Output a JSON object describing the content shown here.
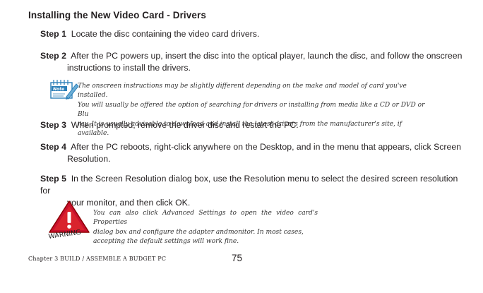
{
  "heading": "Installing the New Video Card - Drivers",
  "steps": [
    {
      "num": "Step 1",
      "line1": "Locate the disc containing the video card drivers.",
      "line2": ""
    },
    {
      "num": "Step 2",
      "line1": "After the PC powers up, insert the disc into the optical player, launch the disc, and follow the onscreen",
      "line2": "instructions to install the drivers."
    },
    {
      "num": "Step 3",
      "line1": "When prompted, remove the driver disc and restart the PC.",
      "line2": ""
    },
    {
      "num": "Step 4",
      "line1": "After the PC reboots, right-click anywhere on the Desktop, and in the menu that appears, click Screen",
      "line2": "Resolution."
    },
    {
      "num": "Step 5",
      "line1": "In the Screen Resolution dialog box, use the Resolution menu to select the desired screen resolution for",
      "line2": "your monitor, and then click OK."
    }
  ],
  "note": {
    "icon_label": "Note",
    "lines": [
      "The onscreen instructions may be slightly different depending on the make and model of card you've installed.",
      "You will usually be offered the option of searching for drivers or installing from media like a CD or DVD or Blu",
      "ray. It is usually advisable to download and install the latest drivers from the manufacturer's site, if available."
    ]
  },
  "warning": {
    "icon_label": "WARNING",
    "lines": [
      "You can also click Advanced Settings to open the video card's Properties",
      "dialog box and configure the adapter andmonitor. In most cases,",
      "accepting the default settings will work fine."
    ]
  },
  "footer": {
    "chapter": "Chapter 3 BUILD / ASSEMBLE A BUDGET PC",
    "page": "75"
  }
}
